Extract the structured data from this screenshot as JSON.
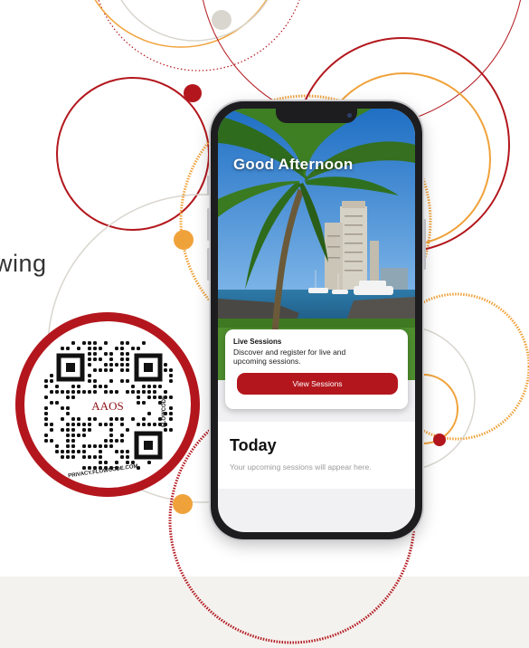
{
  "colors": {
    "accent_red": "#b3171d",
    "accent_orange": "#f0a23a",
    "ring_gray": "#d9d6cf",
    "band_bg": "#f4f2ef"
  },
  "background": {
    "partial_word": "wing"
  },
  "qr_badge": {
    "logo_text": "AAOS",
    "brand_text": "FLOWCODE",
    "url_text": "PRIVACY.FLOWCODE.COM"
  },
  "app": {
    "greeting": "Good Afternoon",
    "live_sessions": {
      "title": "Live Sessions",
      "description": "Discover and register for live and upcoming sessions.",
      "button_label": "View Sessions"
    },
    "today": {
      "title": "Today",
      "empty_message": "Your upcoming sessions will appear here."
    }
  }
}
